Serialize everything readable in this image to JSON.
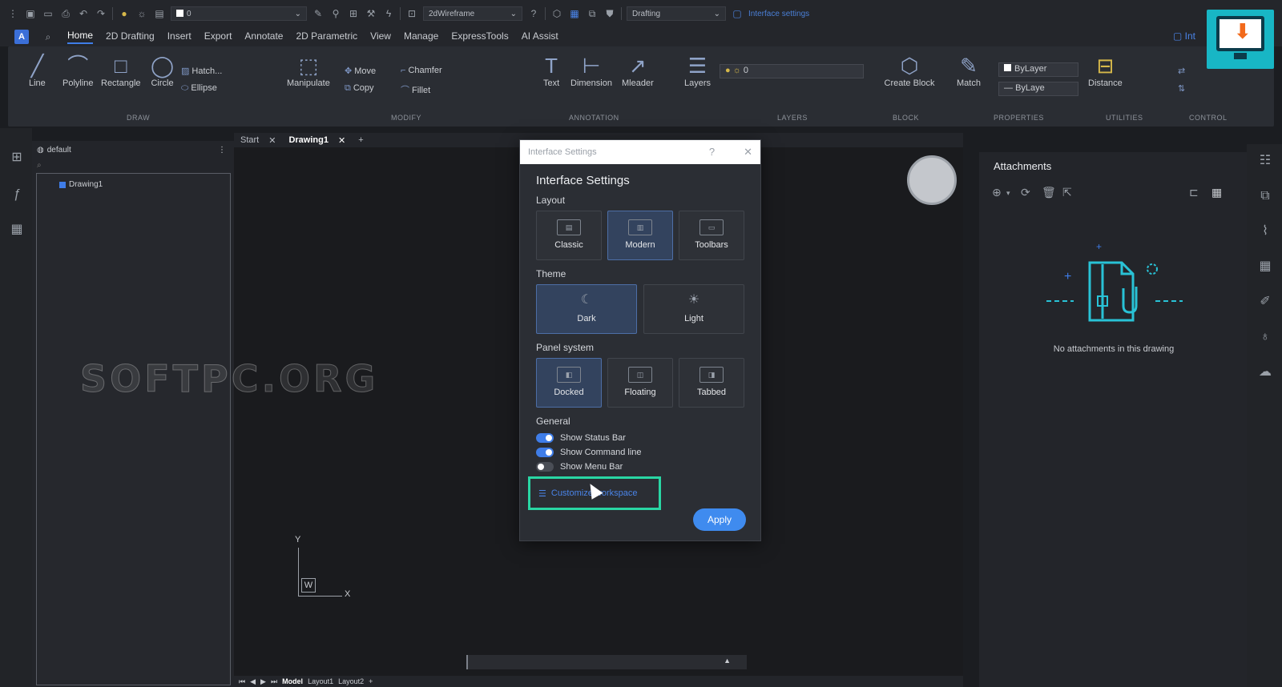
{
  "quick_access": {
    "layer_value": "0",
    "visual_style": "2dWireframe",
    "workspace": "Drafting",
    "interface_settings_link": "Interface settings"
  },
  "menu_tabs": [
    "Home",
    "2D Drafting",
    "Insert",
    "Export",
    "Annotate",
    "2D Parametric",
    "View",
    "Manage",
    "ExpressTools",
    "AI Assist"
  ],
  "active_tab": "Home",
  "header_right": "Int",
  "ribbon": {
    "draw": {
      "label": "DRAW",
      "line": "Line",
      "polyline": "Polyline",
      "rectangle": "Rectangle",
      "circle": "Circle",
      "hatch": "Hatch...",
      "ellipse": "Ellipse"
    },
    "modify": {
      "label": "MODIFY",
      "manipulate": "Manipulate",
      "move": "Move",
      "copy": "Copy",
      "chamfer": "Chamfer",
      "fillet": "Fillet"
    },
    "annotation": {
      "label": "ANNOTATION",
      "text": "Text",
      "dimension": "Dimension",
      "mleader": "Mleader"
    },
    "layers": {
      "label": "LAYERS",
      "layers": "Layers",
      "current": "0"
    },
    "block": {
      "label": "BLOCK",
      "create": "Create Block"
    },
    "properties": {
      "label": "PROPERTIES",
      "match": "Match",
      "color": "ByLayer",
      "linetype": "ByLaye"
    },
    "utilities": {
      "label": "UTILITIES",
      "distance": "Distance"
    },
    "control": {
      "label": "CONTROL"
    }
  },
  "browser": {
    "header": "default",
    "tree_item": "Drawing1"
  },
  "doc_tabs": {
    "start": "Start",
    "drawing": "Drawing1",
    "add": "+"
  },
  "canvas": {
    "ucs_y": "Y",
    "ucs_x": "X",
    "ucs_w": "W"
  },
  "layout_tabs": {
    "model": "Model",
    "layout1": "Layout1",
    "layout2": "Layout2",
    "add": "+"
  },
  "watermark": "SOFTPC.ORG",
  "dialog": {
    "titlebar": "Interface Settings",
    "help": "?",
    "close": "✕",
    "heading": "Interface Settings",
    "layout_section": "Layout",
    "layout_options": [
      "Classic",
      "Modern",
      "Toolbars"
    ],
    "layout_selected": "Modern",
    "theme_section": "Theme",
    "theme_options": [
      "Dark",
      "Light"
    ],
    "theme_selected": "Dark",
    "panel_section": "Panel system",
    "panel_options": [
      "Docked",
      "Floating",
      "Tabbed"
    ],
    "panel_selected": "Docked",
    "general_section": "General",
    "toggles": [
      {
        "label": "Show Status Bar",
        "on": true
      },
      {
        "label": "Show Command line",
        "on": true
      },
      {
        "label": "Show Menu Bar",
        "on": false
      }
    ],
    "customize_link": "Customize workspace",
    "apply": "Apply"
  },
  "attachments": {
    "title": "Attachments",
    "empty_text": "No attachments in this drawing"
  },
  "colors": {
    "accent": "#3f7de8",
    "highlight": "#29d6a4",
    "background": "#1b1d21"
  }
}
